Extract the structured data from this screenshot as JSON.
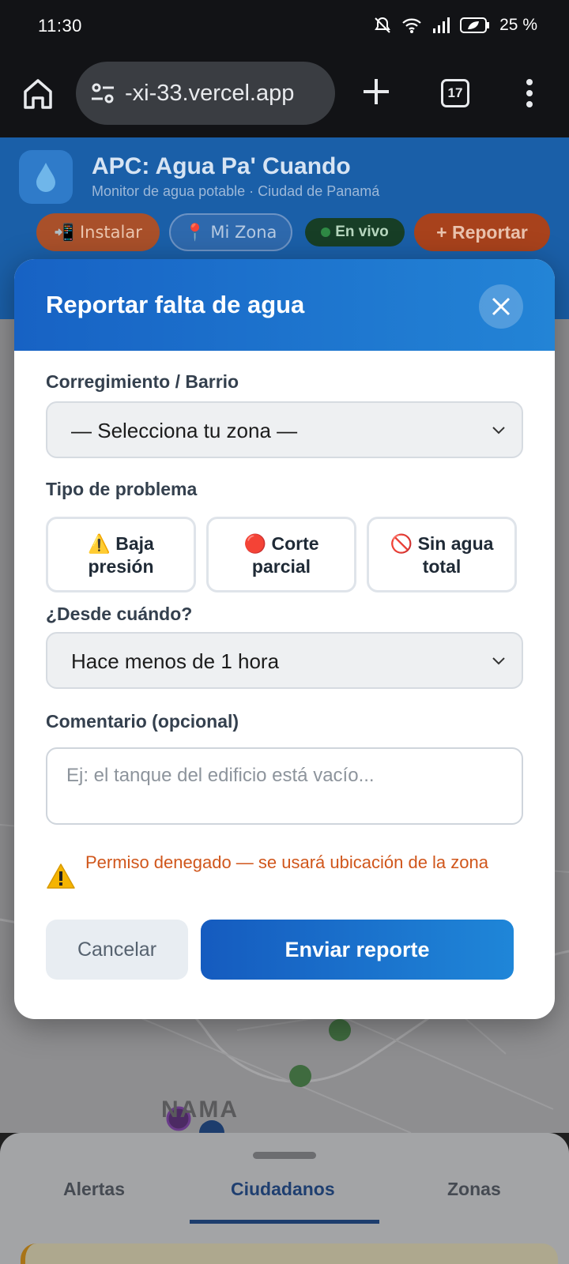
{
  "status_bar": {
    "time": "11:30",
    "battery": "25 %",
    "icons": [
      "bell-muted-icon",
      "wifi-icon",
      "signal-icon",
      "battery-saver-icon"
    ]
  },
  "browser": {
    "url": "-xi-33.vercel.app",
    "tab_count": "17",
    "icons": [
      "home-icon",
      "site-settings-icon",
      "new-tab-icon",
      "tabs-icon",
      "more-icon"
    ]
  },
  "app": {
    "title": "APC: Agua Pa' Cuando",
    "subtitle": "Monitor de agua potable · Ciudad de Panamá",
    "install_label": "📲 Instalar",
    "zone_label": "📍 Mi Zona",
    "live_label": "En vivo",
    "report_label": "+ Reportar",
    "logo_icon": "water-drop-icon"
  },
  "map": {
    "label": "NAMA"
  },
  "bottom_sheet": {
    "tabs": [
      {
        "label": "Alertas"
      },
      {
        "label": "Ciudadanos",
        "active": true
      },
      {
        "label": "Zonas"
      }
    ]
  },
  "modal": {
    "title": "Reportar falta de agua",
    "zone_label": "Corregimiento / Barrio",
    "zone_value": "— Selecciona tu zona —",
    "problem_label": "Tipo de problema",
    "problem_types": [
      {
        "emoji": "⚠️",
        "line1": "Baja",
        "line2": "presión"
      },
      {
        "emoji": "🔴",
        "line1": "Corte",
        "line2": "parcial"
      },
      {
        "emoji": "🚫",
        "line1": "Sin agua",
        "line2": "total"
      }
    ],
    "since_label": "¿Desde cuándo?",
    "since_value": "Hace menos de 1 hora",
    "comment_label": "Comentario (opcional)",
    "comment_placeholder": "Ej: el tanque del edificio está vacío...",
    "warning_text": "Permiso denegado — se usará ubicación de la zona",
    "cancel_label": "Cancelar",
    "submit_label": "Enviar reporte"
  },
  "colors": {
    "modal_header": "#1762c4",
    "submit": "#1f86d8",
    "warning": "#d0561b"
  }
}
